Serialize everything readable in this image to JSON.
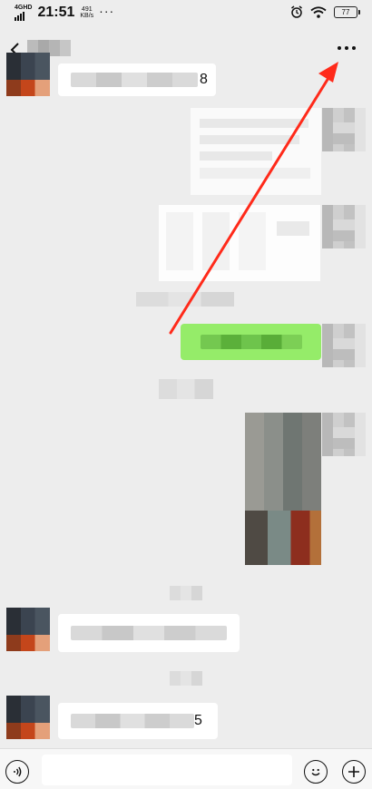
{
  "status_bar": {
    "network": "4GHD",
    "time": "21:51",
    "speed_value": "491",
    "speed_unit": "KB/s",
    "extra": "···",
    "battery": "77"
  },
  "icons": {
    "back": "chevron-left-icon",
    "more": "more-dots-icon",
    "alarm": "alarm-icon",
    "wifi": "wifi-icon",
    "voice": "voice-icon",
    "emoji": "emoji-icon",
    "plus": "plus-icon"
  },
  "messages": {
    "first_suffix": "8",
    "last_suffix": "5"
  },
  "annotation": {
    "color": "#ff2a1a"
  },
  "colors": {
    "chat_background": "#ededed",
    "sent_bubble": "#95ec69",
    "received_bubble": "#ffffff"
  }
}
